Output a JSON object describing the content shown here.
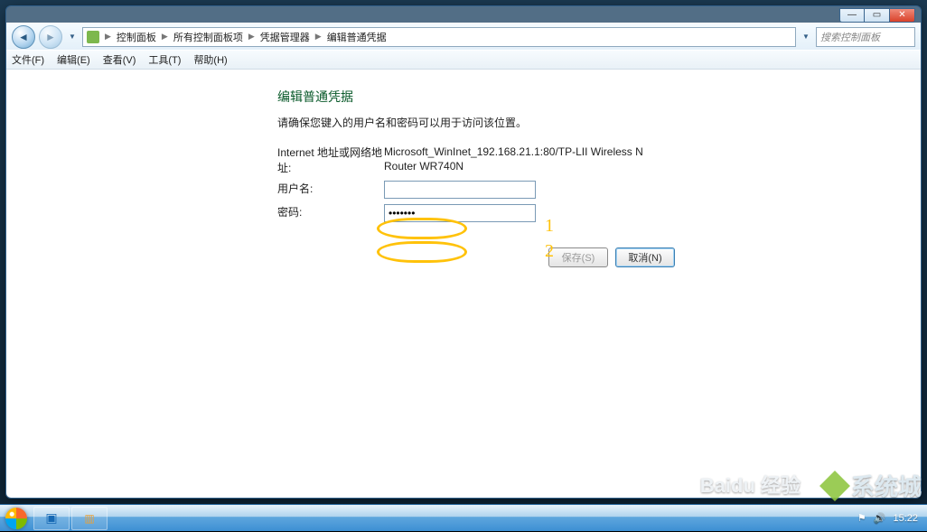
{
  "breadcrumbs": {
    "b0": "控制面板",
    "b1": "所有控制面板项",
    "b2": "凭据管理器",
    "b3": "编辑普通凭据"
  },
  "search": {
    "placeholder": "搜索控制面板"
  },
  "menubar": {
    "file": "文件(F)",
    "edit": "编辑(E)",
    "view": "查看(V)",
    "tools": "工具(T)",
    "help": "帮助(H)"
  },
  "page": {
    "title": "编辑普通凭据",
    "hint": "请确保您键入的用户名和密码可以用于访问该位置。",
    "addr_label": "Internet 地址或网络地址:",
    "addr_value": "Microsoft_WinInet_192.168.21.1:80/TP-LII Wireless N Router WR740N",
    "user_label": "用户名:",
    "user_value": "",
    "pass_label": "密码:",
    "pass_value": "•••••••",
    "save_label": "保存(S)",
    "cancel_label": "取消(N)"
  },
  "annotations": {
    "one": "1",
    "two": "2"
  },
  "taskbar": {
    "clock": "15:22"
  },
  "watermarks": {
    "baidu": "Baidu 经验",
    "site": "系统城"
  }
}
